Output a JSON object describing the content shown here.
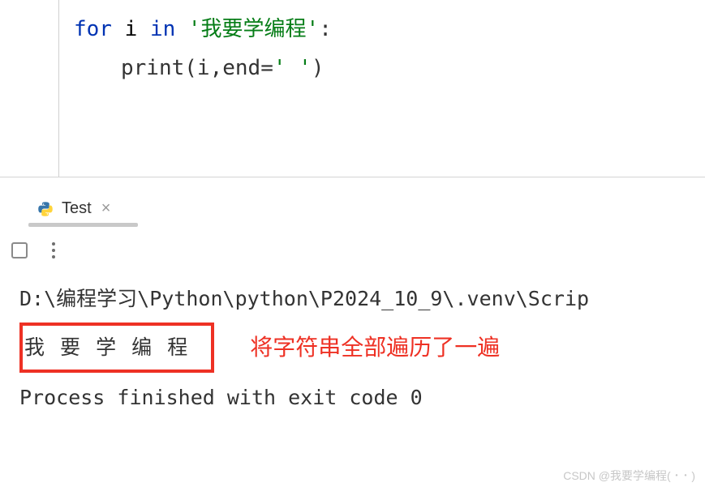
{
  "code": {
    "line1_kw1": "for",
    "line1_var": " i ",
    "line1_kw2": "in",
    "line1_space": " ",
    "line1_str": "'我要学编程'",
    "line1_colon": ":",
    "line2_fn": "print",
    "line2_open": "(i,end=",
    "line2_str": "' '",
    "line2_close": ")"
  },
  "tab": {
    "label": "Test",
    "close": "×"
  },
  "console": {
    "path": "D:\\编程学习\\Python\\python\\P2024_10_9\\.venv\\Scrip",
    "output": "我 要 学 编 程 ",
    "exit": "Process finished with exit code 0"
  },
  "annotation": "将字符串全部遍历了一遍",
  "watermark": "CSDN @我要学编程( ･ ･ )"
}
